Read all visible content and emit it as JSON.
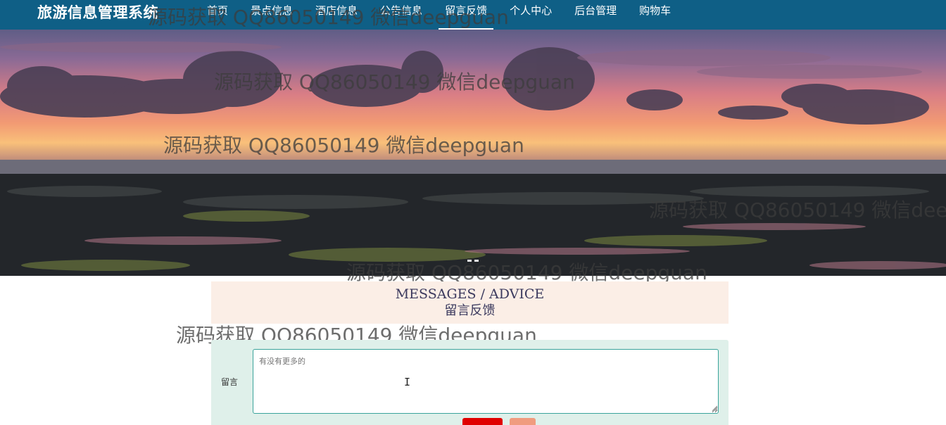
{
  "navbar": {
    "brand": "旅游信息管理系统",
    "items": [
      {
        "label": "首页",
        "active": false
      },
      {
        "label": "景点信息",
        "active": false
      },
      {
        "label": "酒店信息",
        "active": false
      },
      {
        "label": "公告信息",
        "active": false
      },
      {
        "label": "留言反馈",
        "active": true
      },
      {
        "label": "个人中心",
        "active": false
      },
      {
        "label": "后台管理",
        "active": false
      },
      {
        "label": "购物车",
        "active": false
      }
    ]
  },
  "watermark": {
    "text": "源码获取 QQ86050149 微信deepguan"
  },
  "section": {
    "title_en": "MESSAGES / ADVICE",
    "title_cn": "留言反馈"
  },
  "form": {
    "label": "留言",
    "textarea_placeholder": "有没有更多的",
    "accent_color": "#3aa39b",
    "submit_color": "#e00000",
    "reset_color": "#f09c7f"
  },
  "colors": {
    "navbar_bg": "#0f5f86",
    "section_title_bg": "#fbeee6",
    "form_bg": "#dff0ea"
  }
}
